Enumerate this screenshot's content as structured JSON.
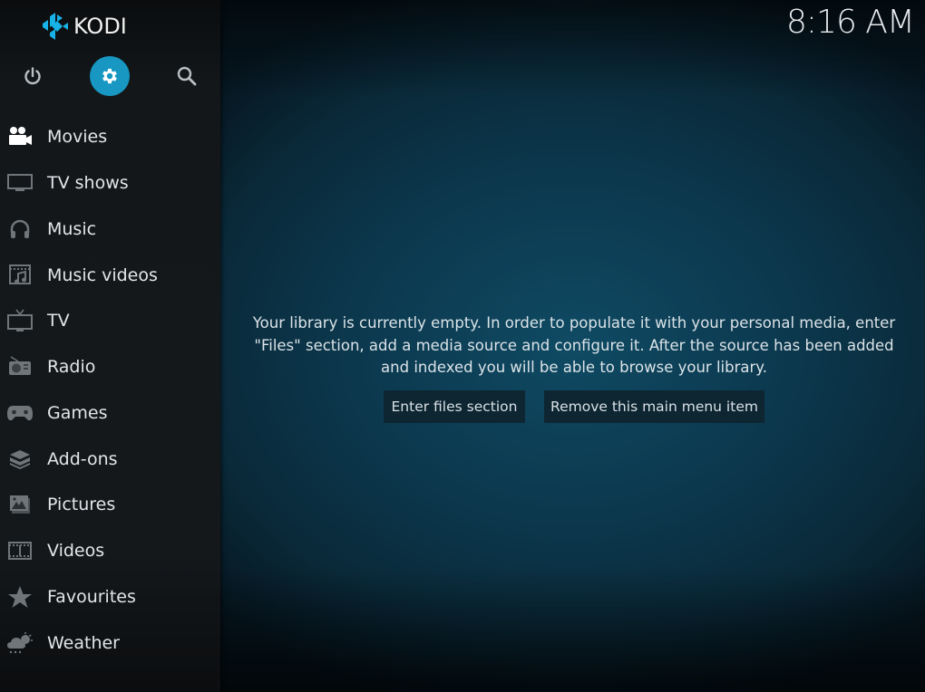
{
  "app": {
    "name": "KODI"
  },
  "clock": {
    "time": "8:16 AM"
  },
  "top_buttons": {
    "power": {
      "icon": "power-icon"
    },
    "settings": {
      "icon": "gear-icon",
      "accent_color": "#1797c2"
    },
    "search": {
      "icon": "search-icon"
    }
  },
  "menu": {
    "items": [
      {
        "label": "Movies",
        "icon": "movie-camera-icon"
      },
      {
        "label": "TV shows",
        "icon": "monitor-icon"
      },
      {
        "label": "Music",
        "icon": "headphones-icon"
      },
      {
        "label": "Music videos",
        "icon": "music-video-icon"
      },
      {
        "label": "TV",
        "icon": "tv-antenna-icon"
      },
      {
        "label": "Radio",
        "icon": "radio-icon"
      },
      {
        "label": "Games",
        "icon": "gamepad-icon"
      },
      {
        "label": "Add-ons",
        "icon": "box-icon"
      },
      {
        "label": "Pictures",
        "icon": "picture-icon"
      },
      {
        "label": "Videos",
        "icon": "film-strip-icon"
      },
      {
        "label": "Favourites",
        "icon": "star-icon"
      },
      {
        "label": "Weather",
        "icon": "weather-icon"
      }
    ]
  },
  "main": {
    "message_lines": [
      "Your library is currently empty. In order to populate it with your personal media, enter",
      "\"Files\" section, add a media source and configure it. After the source has been added",
      "and indexed you will be able to browse your library."
    ],
    "buttons": {
      "enter_files": "Enter files section",
      "remove_item": "Remove this main menu item"
    }
  }
}
